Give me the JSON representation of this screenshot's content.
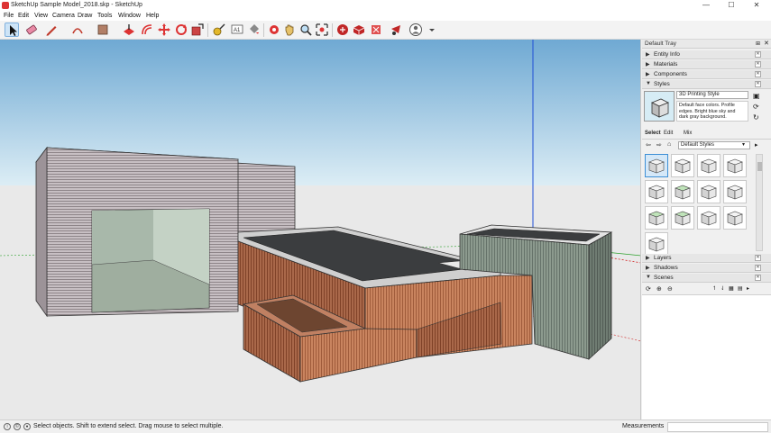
{
  "window": {
    "title": "SketchUp Sample Model_2018.skp - SketchUp",
    "minimize": "—",
    "maximize": "☐",
    "close": "✕"
  },
  "menu": [
    "File",
    "Edit",
    "View",
    "Camera",
    "Draw",
    "Tools",
    "Window",
    "Help"
  ],
  "tray": {
    "title": "Default Tray",
    "panels": {
      "entity_info": "Entity Info",
      "materials": "Materials",
      "components": "Components",
      "styles": "Styles",
      "layers": "Layers",
      "shadows": "Shadows",
      "scenes": "Scenes"
    },
    "styles": {
      "name": "3D Printing Style",
      "description": "Default face colors. Profile edges. Bright blue sky and dark gray background.",
      "tabs": [
        "Select",
        "Edit",
        "Mix"
      ],
      "dropdown": "Default Styles"
    }
  },
  "statusbar": {
    "text": "Select objects. Shift to extend select. Drag mouse to select multiple.",
    "measurements_label": "Measurements",
    "measurements_value": ""
  },
  "colors": {
    "accent": "#3d8fd6",
    "sky": "#d6ecf5",
    "ground": "#e9e9e9",
    "blue_axis": "#1f4fd6",
    "green_axis": "#2aa02a",
    "red_axis": "#d02020"
  }
}
